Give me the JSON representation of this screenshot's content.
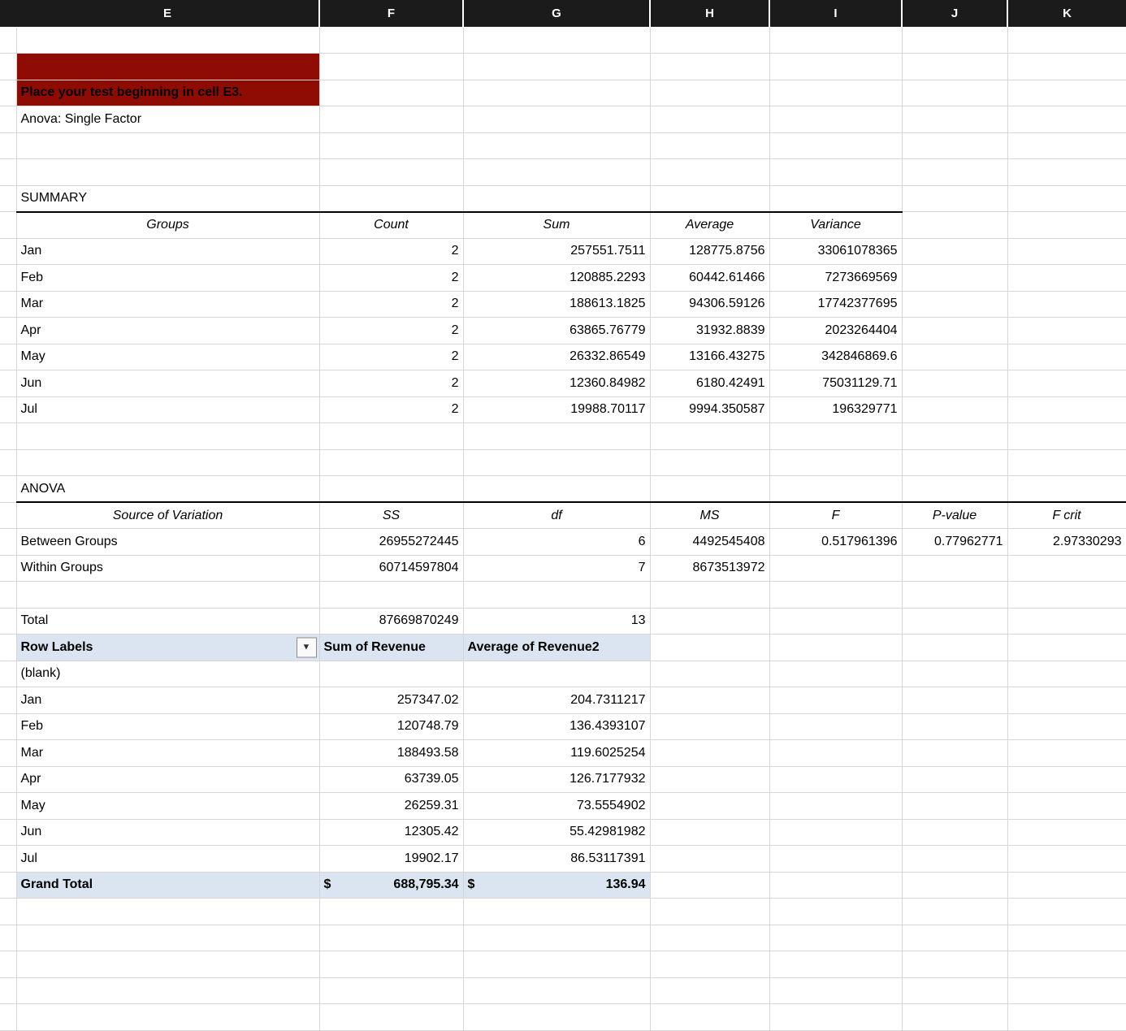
{
  "column_headers": [
    "E",
    "F",
    "G",
    "H",
    "I",
    "J",
    "K"
  ],
  "banner": {
    "text": "Place your test beginning in cell E3."
  },
  "labels": {
    "anova_single_factor": "Anova: Single Factor",
    "summary_title": "SUMMARY",
    "anova_title": "ANOVA"
  },
  "icons": {
    "filter_dropdown": "▼"
  },
  "summary_table": {
    "headers": {
      "groups": "Groups",
      "count": "Count",
      "sum": "Sum",
      "average": "Average",
      "variance": "Variance"
    },
    "rows": [
      {
        "group": "Jan",
        "count": "2",
        "sum": "257551.7511",
        "average": "128775.8756",
        "variance": "33061078365"
      },
      {
        "group": "Feb",
        "count": "2",
        "sum": "120885.2293",
        "average": "60442.61466",
        "variance": "7273669569"
      },
      {
        "group": "Mar",
        "count": "2",
        "sum": "188613.1825",
        "average": "94306.59126",
        "variance": "17742377695"
      },
      {
        "group": "Apr",
        "count": "2",
        "sum": "63865.76779",
        "average": "31932.8839",
        "variance": "2023264404"
      },
      {
        "group": "May",
        "count": "2",
        "sum": "26332.86549",
        "average": "13166.43275",
        "variance": "342846869.6"
      },
      {
        "group": "Jun",
        "count": "2",
        "sum": "12360.84982",
        "average": "6180.42491",
        "variance": "75031129.71"
      },
      {
        "group": "Jul",
        "count": "2",
        "sum": "19988.70117",
        "average": "9994.350587",
        "variance": "196329771"
      }
    ]
  },
  "anova_table": {
    "headers": {
      "source": "Source of Variation",
      "ss": "SS",
      "df": "df",
      "ms": "MS",
      "f": "F",
      "p": "P-value",
      "fcrit": "F crit"
    },
    "rows": [
      {
        "source": "Between Groups",
        "ss": "26955272445",
        "df": "6",
        "ms": "4492545408",
        "f": "0.517961396",
        "p": "0.77962771",
        "fcrit": "2.97330293"
      },
      {
        "source": "Within Groups",
        "ss": "60714597804",
        "df": "7",
        "ms": "8673513972"
      }
    ],
    "total_row": {
      "label": "Total",
      "ss": "87669870249",
      "df": "13"
    }
  },
  "pivot_table": {
    "headers": {
      "row_labels": "Row Labels",
      "sum": "Sum of Revenue",
      "average": "Average of Revenue2"
    },
    "rows": [
      {
        "label": "(blank)",
        "sum": "",
        "avg": ""
      },
      {
        "label": "Jan",
        "sum": "257347.02",
        "avg": "204.7311217"
      },
      {
        "label": "Feb",
        "sum": "120748.79",
        "avg": "136.4393107"
      },
      {
        "label": "Mar",
        "sum": "188493.58",
        "avg": "119.6025254"
      },
      {
        "label": "Apr",
        "sum": "63739.05",
        "avg": "126.7177932"
      },
      {
        "label": "May",
        "sum": "26259.31",
        "avg": "73.5554902"
      },
      {
        "label": "Jun",
        "sum": "12305.42",
        "avg": "55.42981982"
      },
      {
        "label": "Jul",
        "sum": "19902.17",
        "avg": "86.53117391"
      }
    ],
    "grand_total": {
      "label": "Grand Total",
      "sum_symbol": "$",
      "sum_value": "688,795.34",
      "avg_symbol": "$",
      "avg_value": "136.94"
    }
  },
  "colors": {
    "banner_bg": "#8e0c04",
    "pivot_header_bg": "#dbe5f1",
    "column_header_bg": "#1b1b1b",
    "gridline": "#d6d6d6"
  }
}
